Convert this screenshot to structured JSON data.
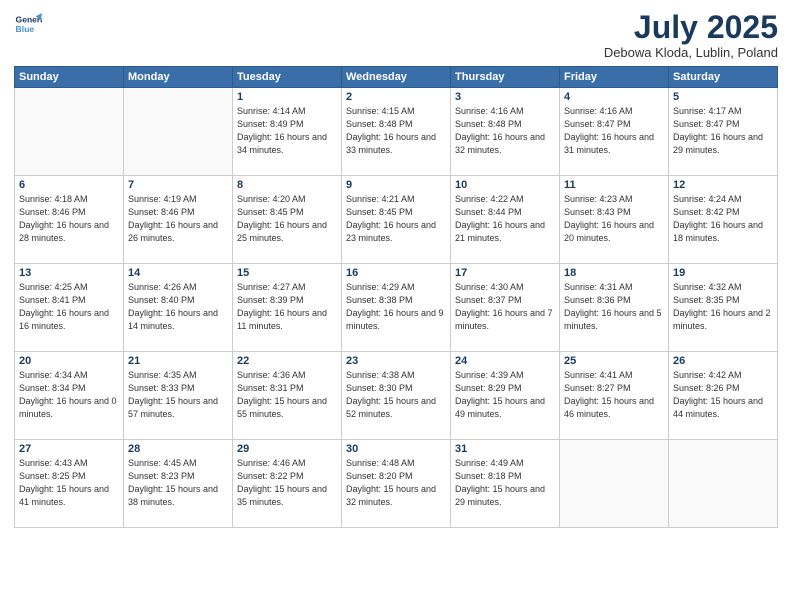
{
  "header": {
    "logo_line1": "General",
    "logo_line2": "Blue",
    "month_title": "July 2025",
    "location": "Debowa Kloda, Lublin, Poland"
  },
  "weekdays": [
    "Sunday",
    "Monday",
    "Tuesday",
    "Wednesday",
    "Thursday",
    "Friday",
    "Saturday"
  ],
  "weeks": [
    [
      {
        "day": "",
        "text": ""
      },
      {
        "day": "",
        "text": ""
      },
      {
        "day": "1",
        "text": "Sunrise: 4:14 AM\nSunset: 8:49 PM\nDaylight: 16 hours\nand 34 minutes."
      },
      {
        "day": "2",
        "text": "Sunrise: 4:15 AM\nSunset: 8:48 PM\nDaylight: 16 hours\nand 33 minutes."
      },
      {
        "day": "3",
        "text": "Sunrise: 4:16 AM\nSunset: 8:48 PM\nDaylight: 16 hours\nand 32 minutes."
      },
      {
        "day": "4",
        "text": "Sunrise: 4:16 AM\nSunset: 8:47 PM\nDaylight: 16 hours\nand 31 minutes."
      },
      {
        "day": "5",
        "text": "Sunrise: 4:17 AM\nSunset: 8:47 PM\nDaylight: 16 hours\nand 29 minutes."
      }
    ],
    [
      {
        "day": "6",
        "text": "Sunrise: 4:18 AM\nSunset: 8:46 PM\nDaylight: 16 hours\nand 28 minutes."
      },
      {
        "day": "7",
        "text": "Sunrise: 4:19 AM\nSunset: 8:46 PM\nDaylight: 16 hours\nand 26 minutes."
      },
      {
        "day": "8",
        "text": "Sunrise: 4:20 AM\nSunset: 8:45 PM\nDaylight: 16 hours\nand 25 minutes."
      },
      {
        "day": "9",
        "text": "Sunrise: 4:21 AM\nSunset: 8:45 PM\nDaylight: 16 hours\nand 23 minutes."
      },
      {
        "day": "10",
        "text": "Sunrise: 4:22 AM\nSunset: 8:44 PM\nDaylight: 16 hours\nand 21 minutes."
      },
      {
        "day": "11",
        "text": "Sunrise: 4:23 AM\nSunset: 8:43 PM\nDaylight: 16 hours\nand 20 minutes."
      },
      {
        "day": "12",
        "text": "Sunrise: 4:24 AM\nSunset: 8:42 PM\nDaylight: 16 hours\nand 18 minutes."
      }
    ],
    [
      {
        "day": "13",
        "text": "Sunrise: 4:25 AM\nSunset: 8:41 PM\nDaylight: 16 hours\nand 16 minutes."
      },
      {
        "day": "14",
        "text": "Sunrise: 4:26 AM\nSunset: 8:40 PM\nDaylight: 16 hours\nand 14 minutes."
      },
      {
        "day": "15",
        "text": "Sunrise: 4:27 AM\nSunset: 8:39 PM\nDaylight: 16 hours\nand 11 minutes."
      },
      {
        "day": "16",
        "text": "Sunrise: 4:29 AM\nSunset: 8:38 PM\nDaylight: 16 hours\nand 9 minutes."
      },
      {
        "day": "17",
        "text": "Sunrise: 4:30 AM\nSunset: 8:37 PM\nDaylight: 16 hours\nand 7 minutes."
      },
      {
        "day": "18",
        "text": "Sunrise: 4:31 AM\nSunset: 8:36 PM\nDaylight: 16 hours\nand 5 minutes."
      },
      {
        "day": "19",
        "text": "Sunrise: 4:32 AM\nSunset: 8:35 PM\nDaylight: 16 hours\nand 2 minutes."
      }
    ],
    [
      {
        "day": "20",
        "text": "Sunrise: 4:34 AM\nSunset: 8:34 PM\nDaylight: 16 hours\nand 0 minutes."
      },
      {
        "day": "21",
        "text": "Sunrise: 4:35 AM\nSunset: 8:33 PM\nDaylight: 15 hours\nand 57 minutes."
      },
      {
        "day": "22",
        "text": "Sunrise: 4:36 AM\nSunset: 8:31 PM\nDaylight: 15 hours\nand 55 minutes."
      },
      {
        "day": "23",
        "text": "Sunrise: 4:38 AM\nSunset: 8:30 PM\nDaylight: 15 hours\nand 52 minutes."
      },
      {
        "day": "24",
        "text": "Sunrise: 4:39 AM\nSunset: 8:29 PM\nDaylight: 15 hours\nand 49 minutes."
      },
      {
        "day": "25",
        "text": "Sunrise: 4:41 AM\nSunset: 8:27 PM\nDaylight: 15 hours\nand 46 minutes."
      },
      {
        "day": "26",
        "text": "Sunrise: 4:42 AM\nSunset: 8:26 PM\nDaylight: 15 hours\nand 44 minutes."
      }
    ],
    [
      {
        "day": "27",
        "text": "Sunrise: 4:43 AM\nSunset: 8:25 PM\nDaylight: 15 hours\nand 41 minutes."
      },
      {
        "day": "28",
        "text": "Sunrise: 4:45 AM\nSunset: 8:23 PM\nDaylight: 15 hours\nand 38 minutes."
      },
      {
        "day": "29",
        "text": "Sunrise: 4:46 AM\nSunset: 8:22 PM\nDaylight: 15 hours\nand 35 minutes."
      },
      {
        "day": "30",
        "text": "Sunrise: 4:48 AM\nSunset: 8:20 PM\nDaylight: 15 hours\nand 32 minutes."
      },
      {
        "day": "31",
        "text": "Sunrise: 4:49 AM\nSunset: 8:18 PM\nDaylight: 15 hours\nand 29 minutes."
      },
      {
        "day": "",
        "text": ""
      },
      {
        "day": "",
        "text": ""
      }
    ]
  ]
}
